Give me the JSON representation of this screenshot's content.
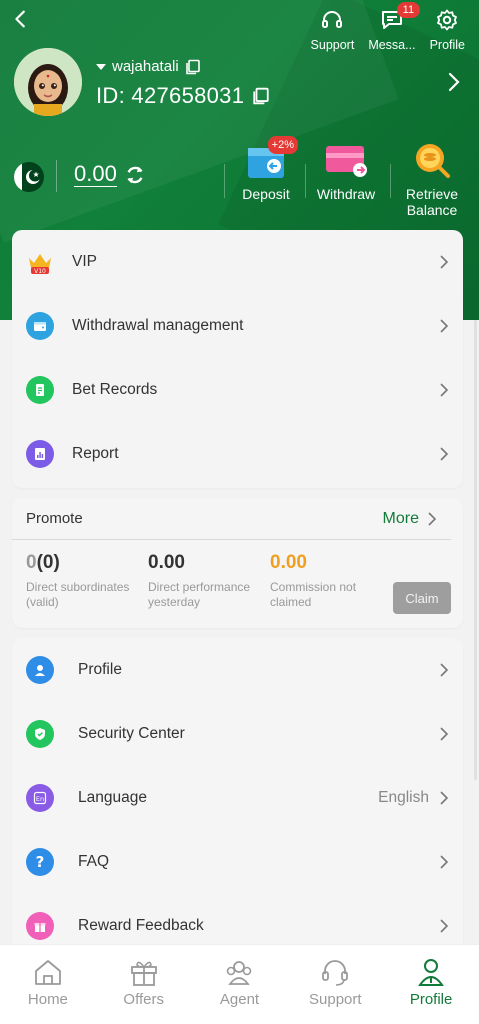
{
  "header": {
    "actions": [
      {
        "label": "Support",
        "icon": "headset-icon"
      },
      {
        "label": "Messa...",
        "icon": "message-icon",
        "badge": "11"
      },
      {
        "label": "Profile",
        "icon": "gear-icon"
      }
    ],
    "username": "wajahatali",
    "user_id": "ID: 427658031"
  },
  "wallet": {
    "balance": "0.00",
    "deposit_label": "Deposit",
    "deposit_badge": "+2%",
    "withdraw_label": "Withdraw",
    "retrieve_label_1": "Retrieve",
    "retrieve_label_2": "Balance"
  },
  "menu1": [
    {
      "label": "VIP",
      "icon": "vip-crown-icon"
    },
    {
      "label": "Withdrawal management",
      "icon": "wallet-icon"
    },
    {
      "label": "Bet Records",
      "icon": "document-icon"
    },
    {
      "label": "Report",
      "icon": "report-chart-icon"
    }
  ],
  "promote": {
    "title": "Promote",
    "more": "More",
    "stats": [
      {
        "value_main": "0",
        "value_sub": "(0)",
        "label": "Direct subordinates (valid)"
      },
      {
        "value": "0.00",
        "label": "Direct performance yesterday"
      },
      {
        "value": "0.00",
        "label": "Commission not claimed"
      }
    ],
    "claim": "Claim"
  },
  "menu2": [
    {
      "label": "Profile",
      "icon": "user-icon"
    },
    {
      "label": "Security Center",
      "icon": "shield-icon"
    },
    {
      "label": "Language",
      "icon": "language-icon",
      "value": "English"
    },
    {
      "label": "FAQ",
      "icon": "question-icon"
    },
    {
      "label": "Reward Feedback",
      "icon": "gift-icon"
    }
  ],
  "nav": [
    {
      "label": "Home",
      "icon": "home-icon"
    },
    {
      "label": "Offers",
      "icon": "gift-box-icon"
    },
    {
      "label": "Agent",
      "icon": "agent-icon"
    },
    {
      "label": "Support",
      "icon": "support-icon"
    },
    {
      "label": "Profile",
      "icon": "profile-icon",
      "active": true
    }
  ],
  "colors": {
    "brand": "#137b3a",
    "accent_orange": "#f0a020",
    "badge_red": "#e53935"
  }
}
